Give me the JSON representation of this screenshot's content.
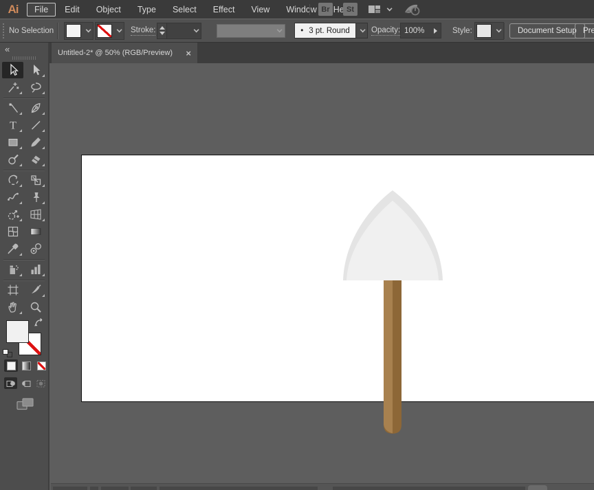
{
  "app": {
    "logo_text": "Ai"
  },
  "menubar": {
    "items": [
      "File",
      "Edit",
      "Object",
      "Type",
      "Select",
      "Effect",
      "View",
      "Window",
      "Help"
    ],
    "focused_item": "File",
    "bridge_button": "Br",
    "stock_button": "St"
  },
  "controlbar": {
    "selection_status": "No Selection",
    "stroke_label": "Stroke:",
    "brush_preview_glyph": "•",
    "brush_value": "3 pt. Round",
    "opacity_label": "Opacity:",
    "opacity_value": "100%",
    "style_label": "Style:",
    "document_setup_button": "Document Setup",
    "preferences_button": "Preferences"
  },
  "tabbar": {
    "tab_title": "Untitled-2* @ 50% (RGB/Preview)",
    "close_glyph": "×"
  },
  "toolbar": {
    "collapse_glyph": "«",
    "selected_tool": "selection-tool",
    "tools": [
      "selection-tool",
      "direct-selection-tool",
      "magic-wand-tool",
      "lasso-tool",
      "curvature-tool",
      "pen-tool",
      "type-tool",
      "line-segment-tool",
      "rectangle-tool",
      "paintbrush-tool",
      "shaper-tool",
      "eraser-tool",
      "rotate-tool",
      "scale-tool",
      "width-tool",
      "puppet-warp-tool",
      "shape-builder-tool",
      "perspective-grid-tool",
      "mesh-tool",
      "gradient-tool",
      "eyedropper-tool",
      "blend-tool",
      "symbol-sprayer-tool",
      "column-graph-tool",
      "artboard-tool",
      "slice-tool",
      "hand-tool",
      "zoom-tool"
    ]
  },
  "canvas": {
    "pasteboard_color": "#5e5e5e",
    "artboard_color": "#ffffff"
  },
  "shovel": {
    "blade_outer_color": "#e4e4e4",
    "blade_inner_color": "#f0f0f0",
    "handle_dark_color": "#8d6737",
    "handle_light_color": "#a8814f"
  },
  "colors": {
    "accent_orange": "#cf8a5b",
    "menubar_bg": "#3a3a3a",
    "controlbar_bg": "#515151",
    "toolpanel_bg": "#4d4d4d",
    "none_slash_red": "#dd1111"
  }
}
